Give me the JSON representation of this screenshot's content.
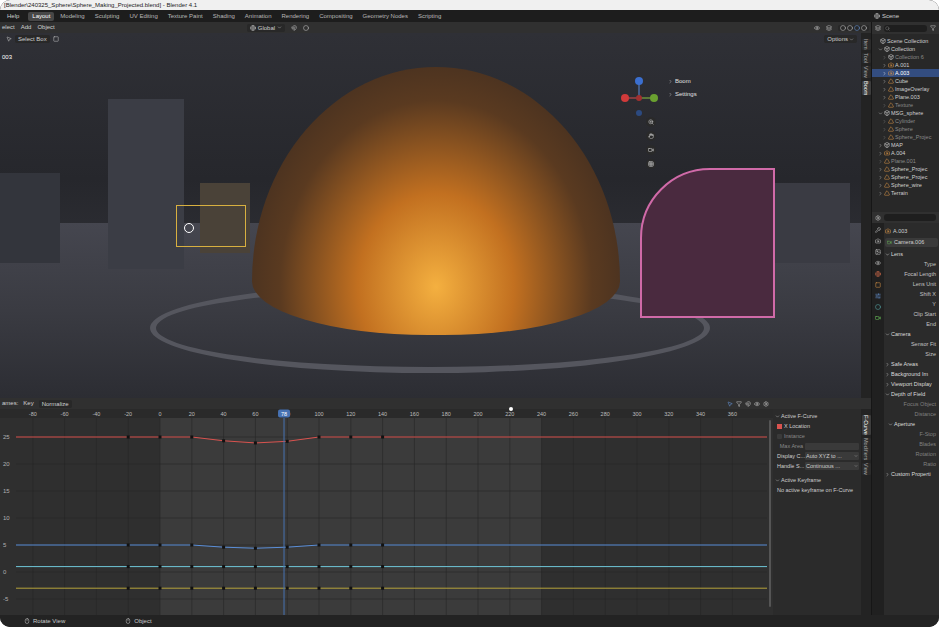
{
  "window": {
    "title": "[Blender\\240325_Sphere\\Sphere_Making_Projected.blend] - Blender 4.1"
  },
  "menu": [
    "Help"
  ],
  "workspaces": [
    {
      "label": "Layout",
      "selected": true
    },
    {
      "label": "Modeling",
      "selected": false
    },
    {
      "label": "Sculpting",
      "selected": false
    },
    {
      "label": "UV Editing",
      "selected": false
    },
    {
      "label": "Texture Paint",
      "selected": false
    },
    {
      "label": "Shading",
      "selected": false
    },
    {
      "label": "Animation",
      "selected": false
    },
    {
      "label": "Rendering",
      "selected": false
    },
    {
      "label": "Compositing",
      "selected": false
    },
    {
      "label": "Geometry Nodes",
      "selected": false
    },
    {
      "label": "Scripting",
      "selected": false
    }
  ],
  "scene": "Scene",
  "viewport": {
    "header": [
      "elect",
      "Add",
      "Object"
    ],
    "orientation": "Global",
    "tool": "Select Box",
    "options": "Options",
    "object_label": "003",
    "panels": [
      "Boom",
      "Settings"
    ],
    "tabs": [
      {
        "label": "Item",
        "selected": false
      },
      {
        "label": "Tool",
        "selected": false
      },
      {
        "label": "View",
        "selected": false
      },
      {
        "label": "Boom",
        "selected": true
      }
    ]
  },
  "graph_editor": {
    "header": {
      "prefix": "ames:",
      "key": "Key",
      "normalize": {
        "label": "Normalize",
        "on": false
      }
    },
    "current_frame": "78",
    "marker_frame": 221,
    "ruler": [
      "-80",
      "-60",
      "-40",
      "-20",
      "0",
      "20",
      "40",
      "60",
      "80",
      "100",
      "120",
      "140",
      "160",
      "180",
      "200",
      "220",
      "240",
      "260",
      "280",
      "300",
      "320",
      "340",
      "360"
    ],
    "y_ticks": [
      "25",
      "20",
      "15",
      "10",
      "5",
      "0",
      "-5"
    ],
    "frame_range": {
      "start": 0,
      "end": 240
    },
    "key_frames": [
      -20,
      0,
      20,
      40,
      60,
      80,
      100,
      120,
      140
    ],
    "series": [
      {
        "color": "#d9534f",
        "values": [
          25,
          25,
          25,
          24.3,
          23.9,
          24.2,
          25,
          25,
          25
        ]
      },
      {
        "color": "#5b8fd9",
        "values": [
          5,
          5,
          5,
          4.6,
          4.4,
          4.6,
          5,
          5,
          5
        ]
      },
      {
        "color": "#6fc6d8",
        "values": [
          1,
          1,
          1,
          1,
          1,
          1,
          1,
          1,
          1
        ]
      },
      {
        "color": "#b5a23a",
        "values": [
          -3,
          -3,
          -3,
          -3,
          -3,
          -3,
          -3,
          -3,
          -3
        ]
      }
    ],
    "sidebar": {
      "section": {
        "label": "Active F-Curve",
        "expanded": true
      },
      "channel": {
        "label": "X Location",
        "color": "#d9534f"
      },
      "rows": [
        {
          "kind": "check",
          "label": "Instance",
          "value": ""
        },
        {
          "kind": "field",
          "label": "Max Area",
          "value": ""
        },
        {
          "kind": "dropdown",
          "label": "Display C...",
          "value": "Auto XYZ to ..."
        },
        {
          "kind": "dropdown",
          "label": "Handle S...",
          "value": "Continuous ..."
        }
      ],
      "keyframe_section": {
        "label": "Active Keyframe",
        "expanded": true
      },
      "keyframe_note": "No active keyframe on F-Curve"
    },
    "tabs": [
      {
        "label": "F-Curve",
        "selected": true
      },
      {
        "label": "Modifiers",
        "selected": false
      },
      {
        "label": "View",
        "selected": false
      }
    ]
  },
  "outliner": {
    "rows": [
      {
        "name": "Scene Collection",
        "depth": 0,
        "kind": "collection",
        "children": false,
        "expanded": true,
        "selected": false,
        "dimmed": false
      },
      {
        "name": "Collection",
        "depth": 1,
        "kind": "collection",
        "children": true,
        "expanded": true,
        "selected": false,
        "dimmed": false
      },
      {
        "name": "Collection 6",
        "depth": 2,
        "kind": "collection",
        "children": true,
        "expanded": false,
        "selected": false,
        "dimmed": true
      },
      {
        "name": "A.001",
        "depth": 2,
        "kind": "camera",
        "children": true,
        "expanded": false,
        "selected": false,
        "dimmed": false
      },
      {
        "name": "A.003",
        "depth": 2,
        "kind": "camera",
        "children": true,
        "expanded": false,
        "selected": true,
        "dimmed": false
      },
      {
        "name": "Cube",
        "depth": 2,
        "kind": "object",
        "children": true,
        "expanded": false,
        "selected": false,
        "dimmed": false
      },
      {
        "name": "ImageOverlay",
        "depth": 2,
        "kind": "object",
        "children": true,
        "expanded": false,
        "selected": false,
        "dimmed": false
      },
      {
        "name": "Plane.003",
        "depth": 2,
        "kind": "object",
        "children": true,
        "expanded": false,
        "selected": false,
        "dimmed": false
      },
      {
        "name": "Texture",
        "depth": 2,
        "kind": "object",
        "children": true,
        "expanded": false,
        "selected": false,
        "dimmed": true
      },
      {
        "name": "MSG_sphere",
        "depth": 1,
        "kind": "collection",
        "children": true,
        "expanded": true,
        "selected": false,
        "dimmed": false
      },
      {
        "name": "Cylinder",
        "depth": 2,
        "kind": "object",
        "children": true,
        "expanded": false,
        "selected": false,
        "dimmed": true
      },
      {
        "name": "Sphere",
        "depth": 2,
        "kind": "object",
        "children": true,
        "expanded": false,
        "selected": false,
        "dimmed": true
      },
      {
        "name": "Sphere_Projec",
        "depth": 2,
        "kind": "object",
        "children": true,
        "expanded": false,
        "selected": false,
        "dimmed": true
      },
      {
        "name": "MAP",
        "depth": 1,
        "kind": "collection",
        "children": true,
        "expanded": false,
        "selected": false,
        "dimmed": false
      },
      {
        "name": "A.004",
        "depth": 1,
        "kind": "camera",
        "children": true,
        "expanded": false,
        "selected": false,
        "dimmed": false
      },
      {
        "name": "Plane.001",
        "depth": 1,
        "kind": "object",
        "children": true,
        "expanded": false,
        "selected": false,
        "dimmed": true
      },
      {
        "name": "Sphere_Projec",
        "depth": 1,
        "kind": "object",
        "children": true,
        "expanded": false,
        "selected": false,
        "dimmed": false
      },
      {
        "name": "Sphere_Projec",
        "depth": 1,
        "kind": "object",
        "children": true,
        "expanded": false,
        "selected": false,
        "dimmed": false
      },
      {
        "name": "Sphere_wire",
        "depth": 1,
        "kind": "object",
        "children": true,
        "expanded": false,
        "selected": false,
        "dimmed": false
      },
      {
        "name": "Terrain",
        "depth": 1,
        "kind": "object",
        "children": true,
        "expanded": false,
        "selected": false,
        "dimmed": false
      }
    ]
  },
  "properties": {
    "object": "A.003",
    "data": "Camera.006",
    "rows": [
      {
        "kind": "section",
        "label": "Lens",
        "expanded": true,
        "dimmed": false
      },
      {
        "kind": "field",
        "label": "Type",
        "expanded": false,
        "dimmed": false
      },
      {
        "kind": "field",
        "label": "Focal Length",
        "expanded": false,
        "dimmed": false
      },
      {
        "kind": "field",
        "label": "Lens Unit",
        "expanded": false,
        "dimmed": false
      },
      {
        "kind": "field",
        "label": "Shift X",
        "expanded": false,
        "dimmed": false
      },
      {
        "kind": "field",
        "label": "Y",
        "expanded": false,
        "dimmed": false
      },
      {
        "kind": "field",
        "label": "Clip Start",
        "expanded": false,
        "dimmed": false
      },
      {
        "kind": "field",
        "label": "End",
        "expanded": false,
        "dimmed": false
      },
      {
        "kind": "section",
        "label": "Camera",
        "expanded": true,
        "dimmed": false
      },
      {
        "kind": "field",
        "label": "Sensor Fit",
        "expanded": false,
        "dimmed": false
      },
      {
        "kind": "field",
        "label": "Size",
        "expanded": false,
        "dimmed": false
      },
      {
        "kind": "section",
        "label": "Safe Areas",
        "expanded": false,
        "dimmed": false
      },
      {
        "kind": "section",
        "label": "Background Im",
        "expanded": false,
        "dimmed": false
      },
      {
        "kind": "section",
        "label": "Viewport Display",
        "expanded": false,
        "dimmed": false
      },
      {
        "kind": "section",
        "label": "Depth of Field",
        "expanded": true,
        "dimmed": false
      },
      {
        "kind": "field",
        "label": "Focus Object",
        "expanded": false,
        "dimmed": true
      },
      {
        "kind": "field",
        "label": "Distance",
        "expanded": false,
        "dimmed": true
      },
      {
        "kind": "subsection",
        "label": "Aperture",
        "expanded": true,
        "dimmed": false
      },
      {
        "kind": "field",
        "label": "F-Stop",
        "expanded": false,
        "dimmed": true
      },
      {
        "kind": "field",
        "label": "Blades",
        "expanded": false,
        "dimmed": true
      },
      {
        "kind": "field",
        "label": "Rotation",
        "expanded": false,
        "dimmed": true
      },
      {
        "kind": "field",
        "label": "Ratio",
        "expanded": false,
        "dimmed": true
      },
      {
        "kind": "section",
        "label": "Custom Properti",
        "expanded": false,
        "dimmed": false
      }
    ]
  },
  "status_bar": [
    "Rotate View",
    "Object"
  ]
}
